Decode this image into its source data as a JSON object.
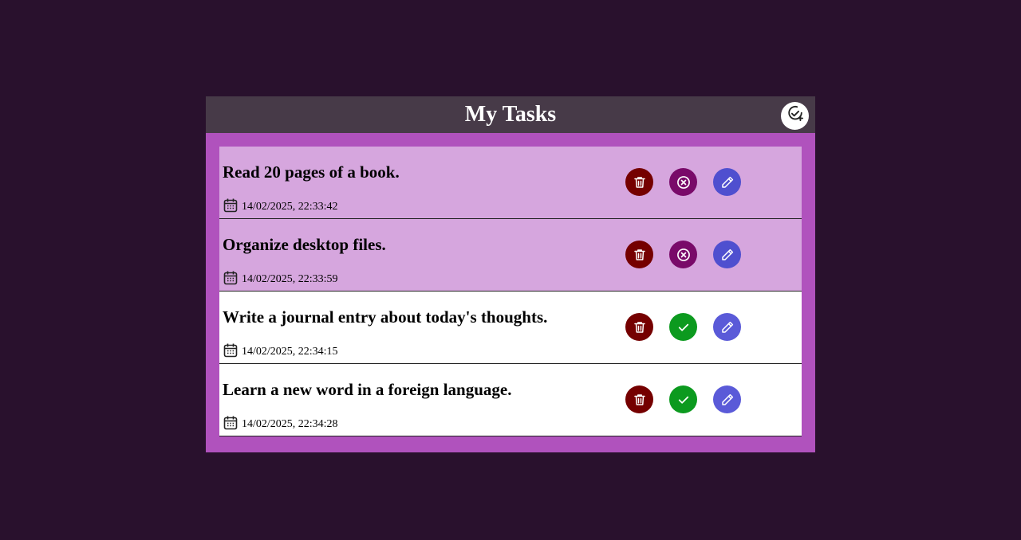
{
  "header": {
    "title": "My Tasks"
  },
  "colors": {
    "background": "#29112d",
    "header_bg": "#473a48",
    "panel_bg": "#b052bd",
    "pending_row_bg": "#d6a6de",
    "done_row_bg": "#ffffff",
    "delete": "#750000",
    "cancel": "#790a69",
    "complete": "#0c9a1f",
    "edit": "#4f4fcf"
  },
  "icons": {
    "add": "add-task-icon",
    "delete": "trash-icon",
    "cancel": "x-circle-icon",
    "complete": "check-icon",
    "edit": "pencil-icon",
    "date": "calendar-icon"
  },
  "tasks": [
    {
      "title": "Read 20 pages of a book.",
      "date": "14/02/2025, 22:33:42",
      "status": "pending"
    },
    {
      "title": "Organize desktop files.",
      "date": "14/02/2025, 22:33:59",
      "status": "pending"
    },
    {
      "title": "Write a journal entry about today's thoughts.",
      "date": "14/02/2025, 22:34:15",
      "status": "done"
    },
    {
      "title": "Learn a new word in a foreign language.",
      "date": "14/02/2025, 22:34:28",
      "status": "done"
    }
  ]
}
